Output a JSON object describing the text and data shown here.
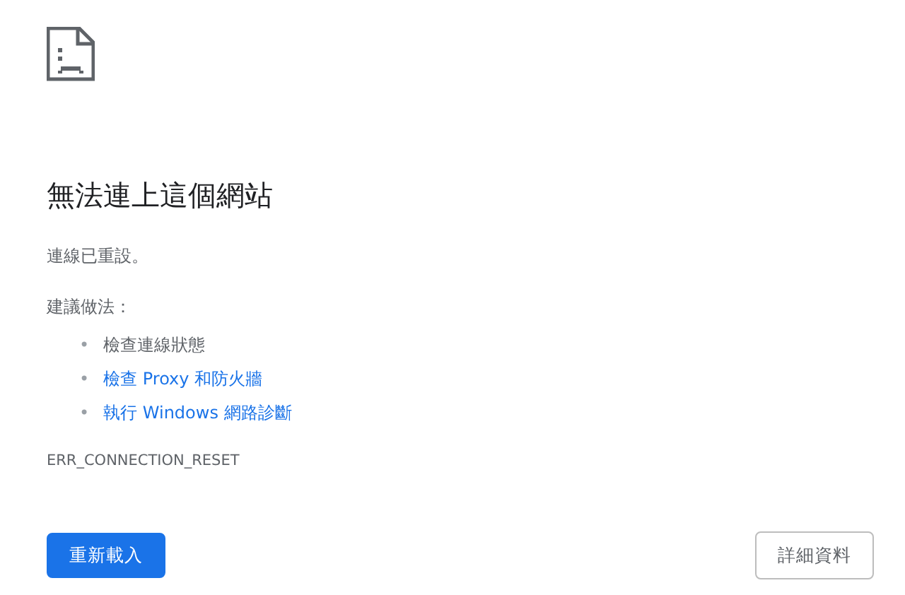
{
  "title": "無法連上這個網站",
  "message": "連線已重設。",
  "suggestions_heading": "建議做法：",
  "suggestions": [
    {
      "kind": "text",
      "bullet": "•",
      "label": "檢查連線狀態"
    },
    {
      "kind": "link",
      "bullet": "•",
      "label": "檢查 Proxy 和防火牆"
    },
    {
      "kind": "link",
      "bullet": "•",
      "label": "執行 Windows 網路診斷"
    }
  ],
  "error_code": "ERR_CONNECTION_RESET",
  "buttons": [
    {
      "kind": "primary",
      "label": "重新載入"
    },
    {
      "kind": "secondary",
      "label": "詳細資料"
    }
  ]
}
